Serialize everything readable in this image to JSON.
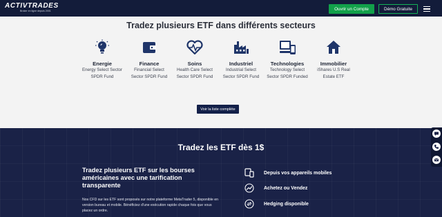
{
  "header": {
    "logo_text": "ACTIVTRADES",
    "logo_tagline": "Broker en ligne depuis 2001",
    "open_account_label": "Ouvrir un Compte",
    "demo_label": "Démo Gratuite",
    "menu_icon": "hamburger-icon"
  },
  "sectors": {
    "title": "Tradez plusieurs ETF dans différents secteurs",
    "items": [
      {
        "icon": "lightbulb-icon",
        "name": "Energie",
        "desc1": "Energy Select Sector",
        "desc2": "SPDR Fund"
      },
      {
        "icon": "wallet-icon",
        "name": "Finance",
        "desc1": "Financial Select",
        "desc2": "Sector SPDR Fund"
      },
      {
        "icon": "heart-pulse-icon",
        "name": "Soins",
        "desc1": "Health Care Select",
        "desc2": "Sector SPDR Fund"
      },
      {
        "icon": "factory-icon",
        "name": "Industriel",
        "desc1": "Industrial Select",
        "desc2": "Sector SPDR Fund"
      },
      {
        "icon": "devices-icon",
        "name": "Technologies",
        "desc1": "Technology Select",
        "desc2": "Sector SPDR Funded"
      },
      {
        "icon": "house-icon",
        "name": "Immobilier",
        "desc1": "iShares U.S Real",
        "desc2": "Estate ETF"
      }
    ],
    "list_button_label": "Voir la liste complète"
  },
  "promo": {
    "title": "Tradez les ETF dès 1$",
    "heading": "Tradez plusieurs ETF sur les bourses américaines avec une tarification transparente",
    "paragraph": "Nos CFD sur les ETF sont proposés sur notre plateforme MetaTrader 5, disponible en version bureau et mobile. Bénéficiez d'une exécution rapide chaque fois que vous placez un ordre.",
    "features": [
      {
        "icon": "devices-outline-icon",
        "label": "Depuis vos appareils mobiles"
      },
      {
        "icon": "trend-icon",
        "label": "Achetez ou Vendez"
      },
      {
        "icon": "hedging-icon",
        "label": "Hedging disponible"
      }
    ]
  },
  "side_widget": {
    "icons": [
      "chat-icon",
      "phone-icon",
      "email-icon"
    ]
  },
  "colors": {
    "navy": "#131c3a",
    "green": "#12a04a",
    "icon_blue": "#1f3569",
    "dark_section": "#1a2247"
  }
}
